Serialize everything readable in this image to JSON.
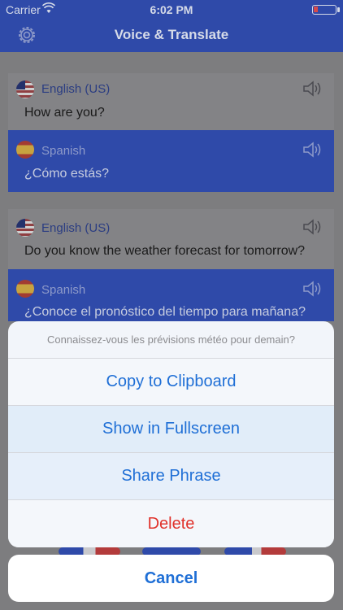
{
  "status_bar": {
    "carrier": "Carrier",
    "time": "6:02 PM"
  },
  "nav": {
    "title": "Voice & Translate",
    "settings_icon": "gear-icon"
  },
  "conversation": [
    {
      "source": {
        "language": "English (US)",
        "flag": "us-flag-icon",
        "text": "How are you?"
      },
      "target": {
        "language": "Spanish",
        "flag": "es-flag-icon",
        "text": "¿Cómo estás?"
      }
    },
    {
      "source": {
        "language": "English (US)",
        "flag": "us-flag-icon",
        "text": "Do you know the weather forecast for tomorrow?"
      },
      "target": {
        "language": "Spanish",
        "flag": "es-flag-icon",
        "text": "¿Conoce el pronóstico del tiempo para mañana?"
      }
    }
  ],
  "action_sheet": {
    "title": "Connaissez-vous les prévisions météo pour demain?",
    "actions": [
      "Copy to Clipboard",
      "Show in Fullscreen",
      "Share Phrase",
      "Delete"
    ],
    "cancel": "Cancel"
  },
  "colors": {
    "nav": "#2f4aa9",
    "action": "#1f6fd6",
    "destructive": "#e0322b"
  }
}
